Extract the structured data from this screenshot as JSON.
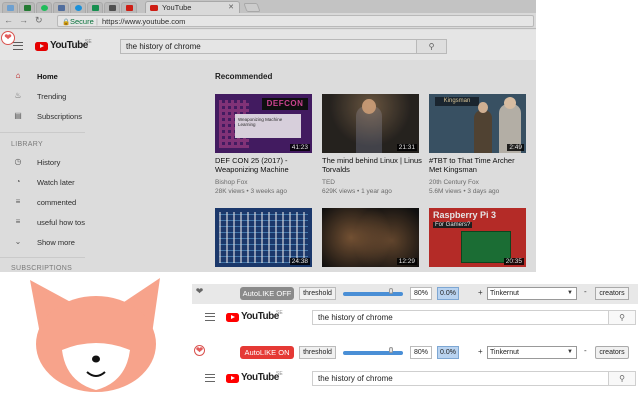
{
  "browser": {
    "tab_title": "YouTube",
    "tab_close": "✕",
    "secure_label": "Secure",
    "url": "https://www.youtube.com",
    "mini_tab_colors": [
      "#7ab3e8",
      "#2a8a3a",
      "#25d366",
      "#5a7bb0",
      "#1da1f2",
      "#1aa05a",
      "#5a5a5a",
      "#e62117"
    ]
  },
  "youtube": {
    "logo_word": "YouTube",
    "logo_country": "SE",
    "search_value": "the history of chrome",
    "search_icon": "search-icon",
    "sidebar": {
      "items_top": [
        {
          "label": "Home",
          "icon": "home-icon",
          "glyph": "⌂"
        },
        {
          "label": "Trending",
          "icon": "flame-icon",
          "glyph": "♨"
        },
        {
          "label": "Subscriptions",
          "icon": "subscriptions-icon",
          "glyph": "▤"
        }
      ],
      "library_heading": "LIBRARY",
      "items_library": [
        {
          "label": "History",
          "icon": "history-icon",
          "glyph": "◷"
        },
        {
          "label": "Watch later",
          "icon": "clock-icon",
          "glyph": "◔"
        },
        {
          "label": "commented",
          "icon": "playlist-icon",
          "glyph": "≡"
        },
        {
          "label": "useful how tos",
          "icon": "playlist-icon",
          "glyph": "≡"
        },
        {
          "label": "Show more",
          "icon": "chevron-down-icon",
          "glyph": "⌄"
        }
      ],
      "subscriptions_heading": "SUBSCRIPTIONS"
    },
    "recommended_heading": "Recommended",
    "videos": [
      {
        "title": "DEF CON 25 (2017) - Weaponizing Machine",
        "channel": "Bishop Fox",
        "stats": "28K views • 3 weeks ago",
        "duration": "41:23",
        "thumb_text_1": "DEFCON",
        "thumb_text_2": "Weaponizing Machine Learning"
      },
      {
        "title": "The mind behind Linux | Linus Torvalds",
        "channel": "TED",
        "stats": "629K views • 1 year ago",
        "duration": "21:31"
      },
      {
        "title": "#TBT to That Time Archer Met Kingsman",
        "channel": "20th Century Fox",
        "stats": "5.6M views • 3 days ago",
        "duration": "2:49",
        "thumb_text_1": "Kingsman"
      },
      {
        "title": "",
        "channel": "",
        "stats": "",
        "duration": "24:38"
      },
      {
        "title": "",
        "channel": "",
        "stats": "",
        "duration": "12:29"
      },
      {
        "title": "",
        "channel": "",
        "stats": "",
        "duration": "20:35",
        "thumb_text_1": "Raspberry Pi 3",
        "thumb_text_2": "For Gamers?"
      }
    ]
  },
  "extension": {
    "off_bar": {
      "autolike_label": "AutoLIKE OFF",
      "threshold_label": "threshold",
      "threshold_percent": "80%",
      "current_value": "0.0%",
      "plus": "+",
      "channel": "Tinkernut",
      "dash": "-",
      "creators_label": "creators",
      "slider_fraction": 0.8
    },
    "on_bar": {
      "autolike_label": "AutoLIKE ON",
      "threshold_label": "threshold",
      "threshold_percent": "80%",
      "current_value": "0.0%",
      "plus": "+",
      "channel": "Tinkernut",
      "dash": "-",
      "creators_label": "creators",
      "slider_fraction": 0.8
    },
    "mini_youtube": {
      "logo_word": "YouTube",
      "logo_country": "SE",
      "search_value": "the history of chrome"
    }
  },
  "colors": {
    "yt_red": "#ff0000",
    "autolike_on": "#e53935",
    "autolike_off": "#8a8a8a",
    "slider_blue": "#4a8fd6",
    "fox_body": "#f7a38b"
  }
}
